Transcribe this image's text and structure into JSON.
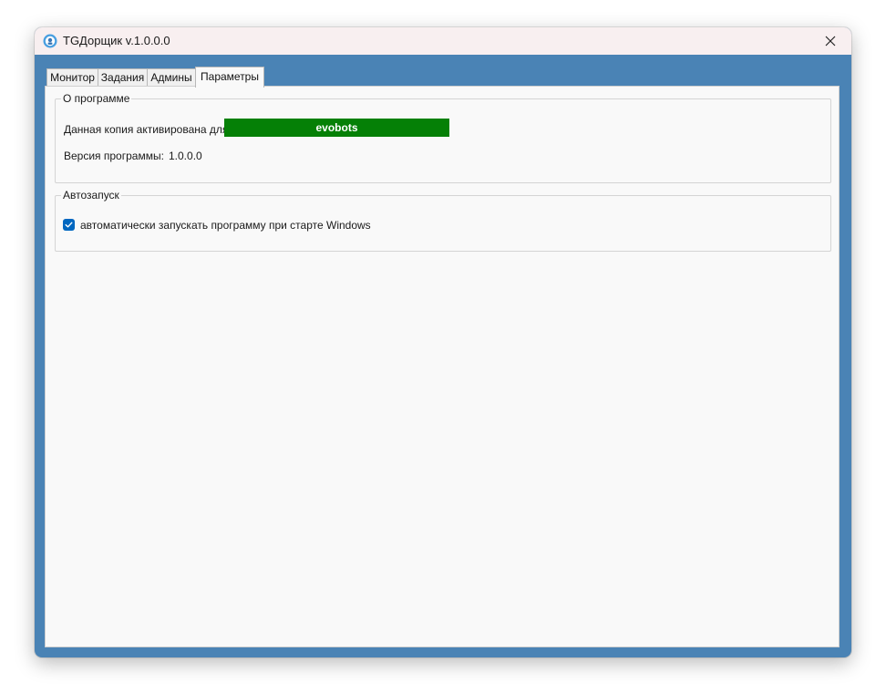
{
  "window": {
    "title": "TGДорщик v.1.0.0.0"
  },
  "tabs": [
    {
      "label": "Монитор"
    },
    {
      "label": "Задания"
    },
    {
      "label": "Админы"
    },
    {
      "label": "Параметры",
      "active": true
    }
  ],
  "about": {
    "legend": "О программе",
    "activated_label": "Данная копия активирована для",
    "licensee": "evobots",
    "version_label": "Версия программы:",
    "version_value": "1.0.0.0"
  },
  "autostart": {
    "legend": "Автозапуск",
    "checkbox_label": "автоматически запускать программу при старте Windows",
    "checked": true
  },
  "colors": {
    "frame": "#4a83b5",
    "titlebar": "#f8eff0",
    "license_bg": "#058006",
    "checkbox": "#0067c0"
  },
  "icons": {
    "app": "app-logo-icon",
    "close": "close-icon",
    "check": "checkmark-icon"
  }
}
